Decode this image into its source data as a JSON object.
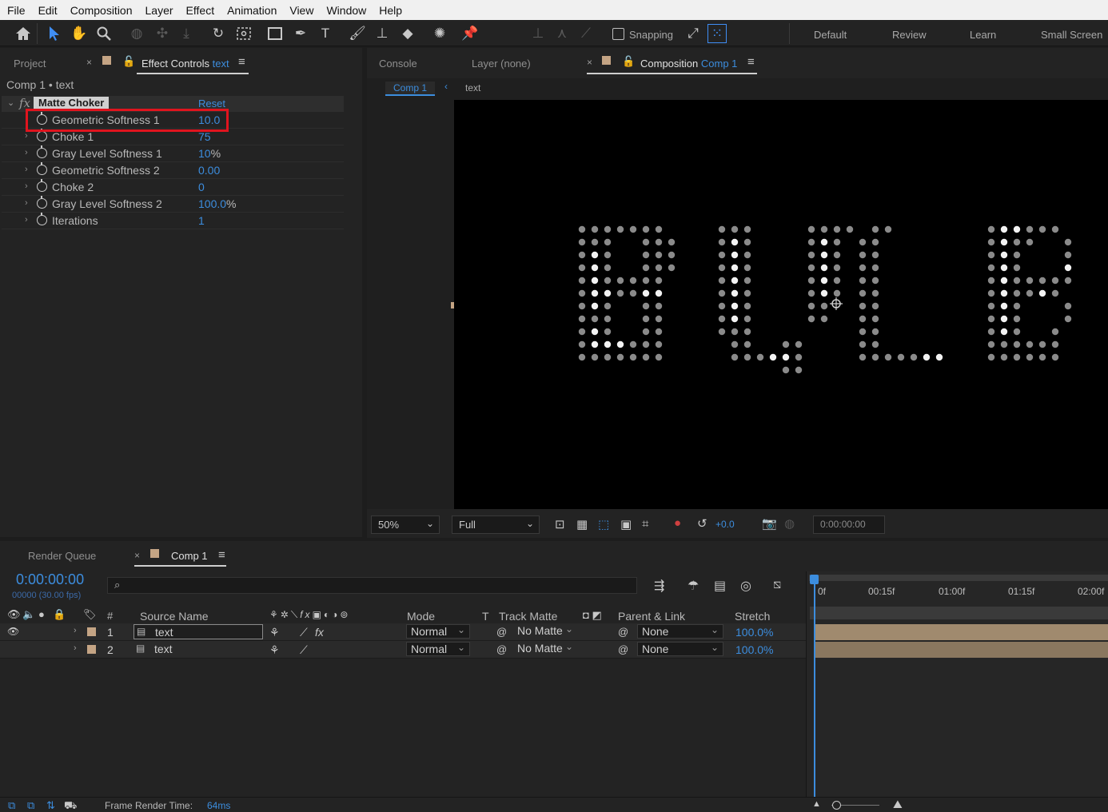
{
  "menu": [
    "File",
    "Edit",
    "Composition",
    "Layer",
    "Effect",
    "Animation",
    "View",
    "Window",
    "Help"
  ],
  "toolbar": {
    "snapping_label": "Snapping",
    "workspaces": [
      "Default",
      "Review",
      "Learn",
      "Small Screen"
    ]
  },
  "left_panel": {
    "tab_project": "Project",
    "tab_effect_controls": "Effect Controls",
    "tab_effect_controls_target": "text",
    "breadcrumb": "Comp 1 • text",
    "effect": {
      "fx": "fx",
      "name": "Matte Choker",
      "reset": "Reset",
      "params": [
        {
          "label": "Geometric Softness 1",
          "value": "10.0",
          "unit": ""
        },
        {
          "label": "Choke 1",
          "value": "75",
          "unit": ""
        },
        {
          "label": "Gray Level Softness 1",
          "value": "10",
          "unit": "%"
        },
        {
          "label": "Geometric Softness 2",
          "value": "0.00",
          "unit": ""
        },
        {
          "label": "Choke 2",
          "value": "0",
          "unit": ""
        },
        {
          "label": "Gray Level Softness 2",
          "value": "100.0",
          "unit": "%"
        },
        {
          "label": "Iterations",
          "value": "1",
          "unit": ""
        }
      ]
    }
  },
  "right_panel": {
    "tab_console": "Console",
    "tab_layer": "Layer (none)",
    "tab_composition": "Composition",
    "tab_composition_target": "Comp 1",
    "crumb_comp": "Comp 1",
    "crumb_layer": "text",
    "zoom": "50%",
    "resolution": "Full",
    "exposure": "+0.0",
    "timecode": "0:00:00:00"
  },
  "timeline": {
    "tab_render_queue": "Render Queue",
    "tab_comp": "Comp 1",
    "current_time": "0:00:00:00",
    "fps": "00000 (30.00 fps)",
    "columns": {
      "num": "#",
      "source_name": "Source Name",
      "mode": "Mode",
      "t": "T",
      "track_matte": "Track Matte",
      "parent": "Parent & Link",
      "stretch": "Stretch"
    },
    "layers": [
      {
        "num": "1",
        "name": "text",
        "mode": "Normal",
        "matte": "No Matte",
        "parent": "None",
        "stretch": "100.0%"
      },
      {
        "num": "2",
        "name": "text",
        "mode": "Normal",
        "matte": "No Matte",
        "parent": "None",
        "stretch": "100.0%"
      }
    ],
    "ruler": [
      "0f",
      "00:15f",
      "01:00f",
      "01:15f",
      "02:00f"
    ]
  },
  "status": {
    "label": "Frame Render Time:",
    "value": "64ms"
  },
  "colors": {
    "accent": "#3c8dde",
    "highlight_box": "#e0141e",
    "label_swatch": "#c4a484"
  }
}
